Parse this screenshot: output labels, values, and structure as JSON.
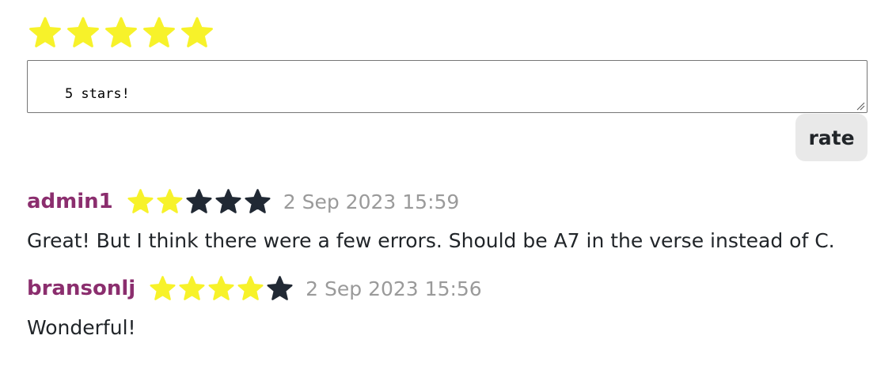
{
  "rating_form": {
    "selected_rating": 5,
    "max_rating": 5,
    "star_colors": {
      "filled": "#f7f22a",
      "empty": "#212934"
    },
    "comment_value": "5 stars!",
    "submit_label": "rate"
  },
  "reviews": [
    {
      "username": "admin1",
      "rating": 2,
      "timestamp": "2 Sep 2023 15:59",
      "text": "Great! But I think there were a few errors. Should be A7 in the verse instead of C."
    },
    {
      "username": "bransonlj",
      "rating": 4,
      "timestamp": "2 Sep 2023 15:56",
      "text": "Wonderful!"
    }
  ],
  "colors": {
    "username": "#8b2e6e",
    "timestamp": "#9a9a9a",
    "button_bg": "#e9e9e9"
  }
}
